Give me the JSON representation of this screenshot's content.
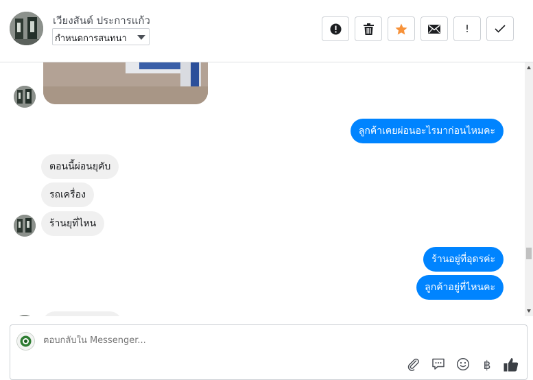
{
  "header": {
    "contact_name": "เวียงสันต์ ประการแก้ว",
    "conversation_select": "กำหนดการสนทนา",
    "actions": [
      {
        "name": "alert",
        "icon": "exclamation-circle-icon"
      },
      {
        "name": "delete",
        "icon": "trash-icon"
      },
      {
        "name": "star",
        "icon": "star-icon",
        "color": "#f7923a"
      },
      {
        "name": "mail",
        "icon": "envelope-icon"
      },
      {
        "name": "important",
        "icon": "exclamation-icon",
        "label": "!"
      },
      {
        "name": "done",
        "icon": "check-icon"
      }
    ]
  },
  "messages": [
    {
      "from": "contact",
      "type": "image"
    },
    {
      "from": "page",
      "text": "ลูกค้าเคยผ่อนอะไรมาก่อนไหมคะ"
    },
    {
      "from": "contact",
      "text": "ตอนนี้ผ่อนยุคับ"
    },
    {
      "from": "contact",
      "text": "รถเครื่อง"
    },
    {
      "from": "contact",
      "text": "ร้านยุที่ไหน"
    },
    {
      "from": "page",
      "text": "ร้านอยู่ที่อุดรค่ะ"
    },
    {
      "from": "page",
      "text": "ลูกค้าอยู่ที่ไหนคะ"
    }
  ],
  "composer": {
    "placeholder": "ตอบกลับใน Messenger...",
    "tools": [
      {
        "name": "attach",
        "icon": "paperclip-icon"
      },
      {
        "name": "saved-replies",
        "icon": "chat-bubble-icon"
      },
      {
        "name": "emoji",
        "icon": "smiley-icon"
      },
      {
        "name": "payment",
        "icon": "baht-icon",
        "label": "฿"
      },
      {
        "name": "like",
        "icon": "thumbs-up-icon"
      }
    ]
  },
  "colors": {
    "outgoing_bubble": "#0084ff",
    "incoming_bubble": "#f0f0f0",
    "star": "#f7923a"
  }
}
